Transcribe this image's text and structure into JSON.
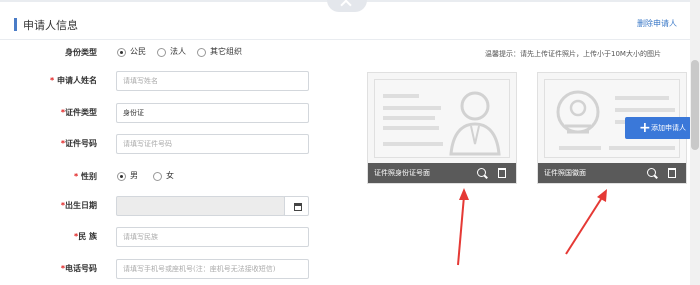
{
  "section": {
    "title": "申请人信息",
    "delete_link": "删除申请人"
  },
  "colors": {
    "accent": "#4a7cc7",
    "link": "#3a78c7",
    "required": "#e02020",
    "add_button": "#3a78d9",
    "arrow": "#e53935"
  },
  "form": {
    "identity_type": {
      "label": "身份类型",
      "options": [
        "公民",
        "法人",
        "其它组织"
      ],
      "selected": "公民"
    },
    "name": {
      "label": "申请人姓名",
      "placeholder": "请填写姓名"
    },
    "id_type": {
      "label": "证件类型",
      "value": "身份证"
    },
    "id_number": {
      "label": "证件号码",
      "placeholder": "请填写证件号码"
    },
    "gender": {
      "label": "性别",
      "options": [
        "男",
        "女"
      ],
      "selected": "男"
    },
    "birth_date": {
      "label": "出生日期",
      "value": ""
    },
    "ethnicity": {
      "label": "民 族",
      "placeholder": "请填写民族"
    },
    "phone": {
      "label": "电话号码",
      "placeholder": "请填写手机号或座机号(注：座机号无法接收短信)"
    }
  },
  "upload": {
    "hint": "温馨提示：请先上传证件照片，上传小于10M大小的图片",
    "cards": [
      {
        "caption": "证件照身份证号面",
        "icons": [
          "zoom-icon",
          "trash-icon"
        ]
      },
      {
        "caption": "证件照国徽面",
        "icons": [
          "zoom-icon",
          "trash-icon"
        ]
      }
    ]
  },
  "add_button": {
    "label": "添加申请人",
    "icon": "plus-icon"
  }
}
